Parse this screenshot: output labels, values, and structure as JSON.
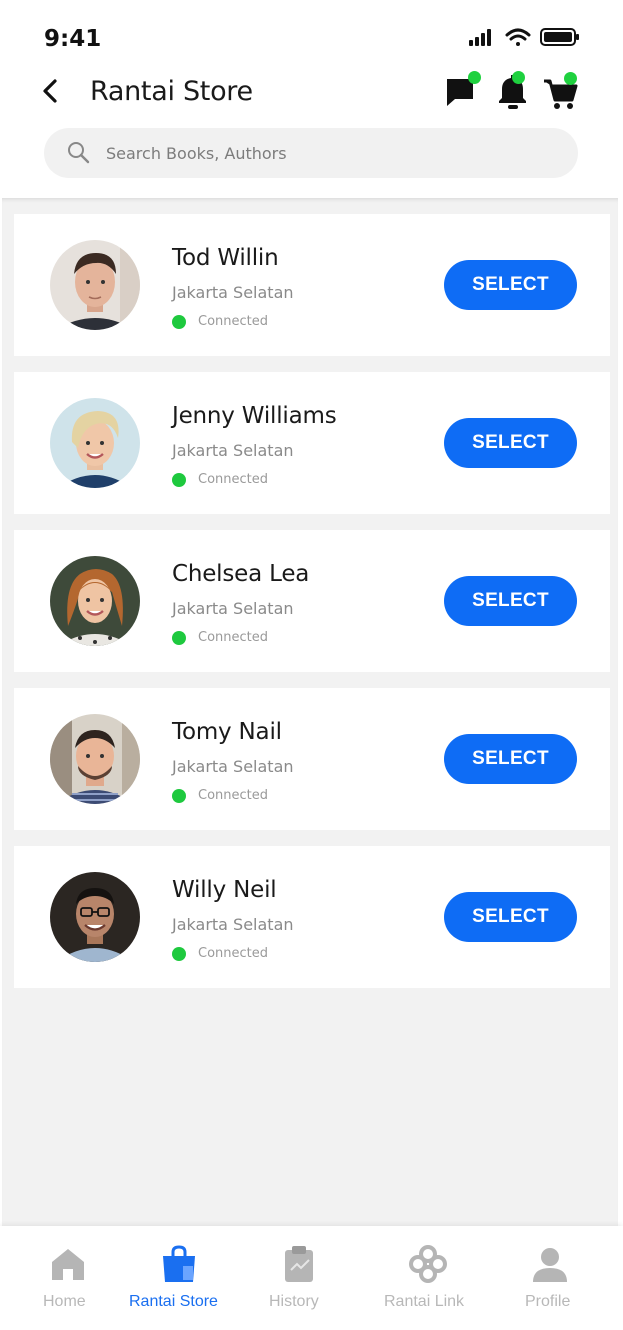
{
  "status_bar": {
    "time": "9:41"
  },
  "header": {
    "title": "Rantai Store",
    "icons": [
      "back-arrow-icon",
      "chat-icon",
      "bell-icon",
      "cart-icon"
    ]
  },
  "search": {
    "placeholder": "Search Books, Authors",
    "value": ""
  },
  "stores": [
    {
      "name": "Tod Willin",
      "location": "Jakarta Selatan",
      "status": "Connected",
      "button_label": "SELECT"
    },
    {
      "name": "Jenny Williams",
      "location": "Jakarta Selatan",
      "status": "Connected",
      "button_label": "SELECT"
    },
    {
      "name": "Chelsea Lea",
      "location": "Jakarta Selatan",
      "status": "Connected",
      "button_label": "SELECT"
    },
    {
      "name": "Tomy Nail",
      "location": "Jakarta Selatan",
      "status": "Connected",
      "button_label": "SELECT"
    },
    {
      "name": "Willy Neil",
      "location": "Jakarta Selatan",
      "status": "Connected",
      "button_label": "SELECT"
    }
  ],
  "tabs": [
    {
      "label": "Home",
      "icon": "home-icon",
      "active": false
    },
    {
      "label": "Rantai Store",
      "icon": "shopping-bag-icon",
      "active": true
    },
    {
      "label": "History",
      "icon": "clipboard-icon",
      "active": false
    },
    {
      "label": "Rantai Link",
      "icon": "link-icon",
      "active": false
    },
    {
      "label": "Profile",
      "icon": "profile-icon",
      "active": false
    }
  ],
  "colors": {
    "accent": "#0e6cf5",
    "active_tab": "#1a6ff0",
    "status_green": "#1ec93e",
    "notification_dot": "#1fd13f",
    "background": "#f2f2f2"
  }
}
